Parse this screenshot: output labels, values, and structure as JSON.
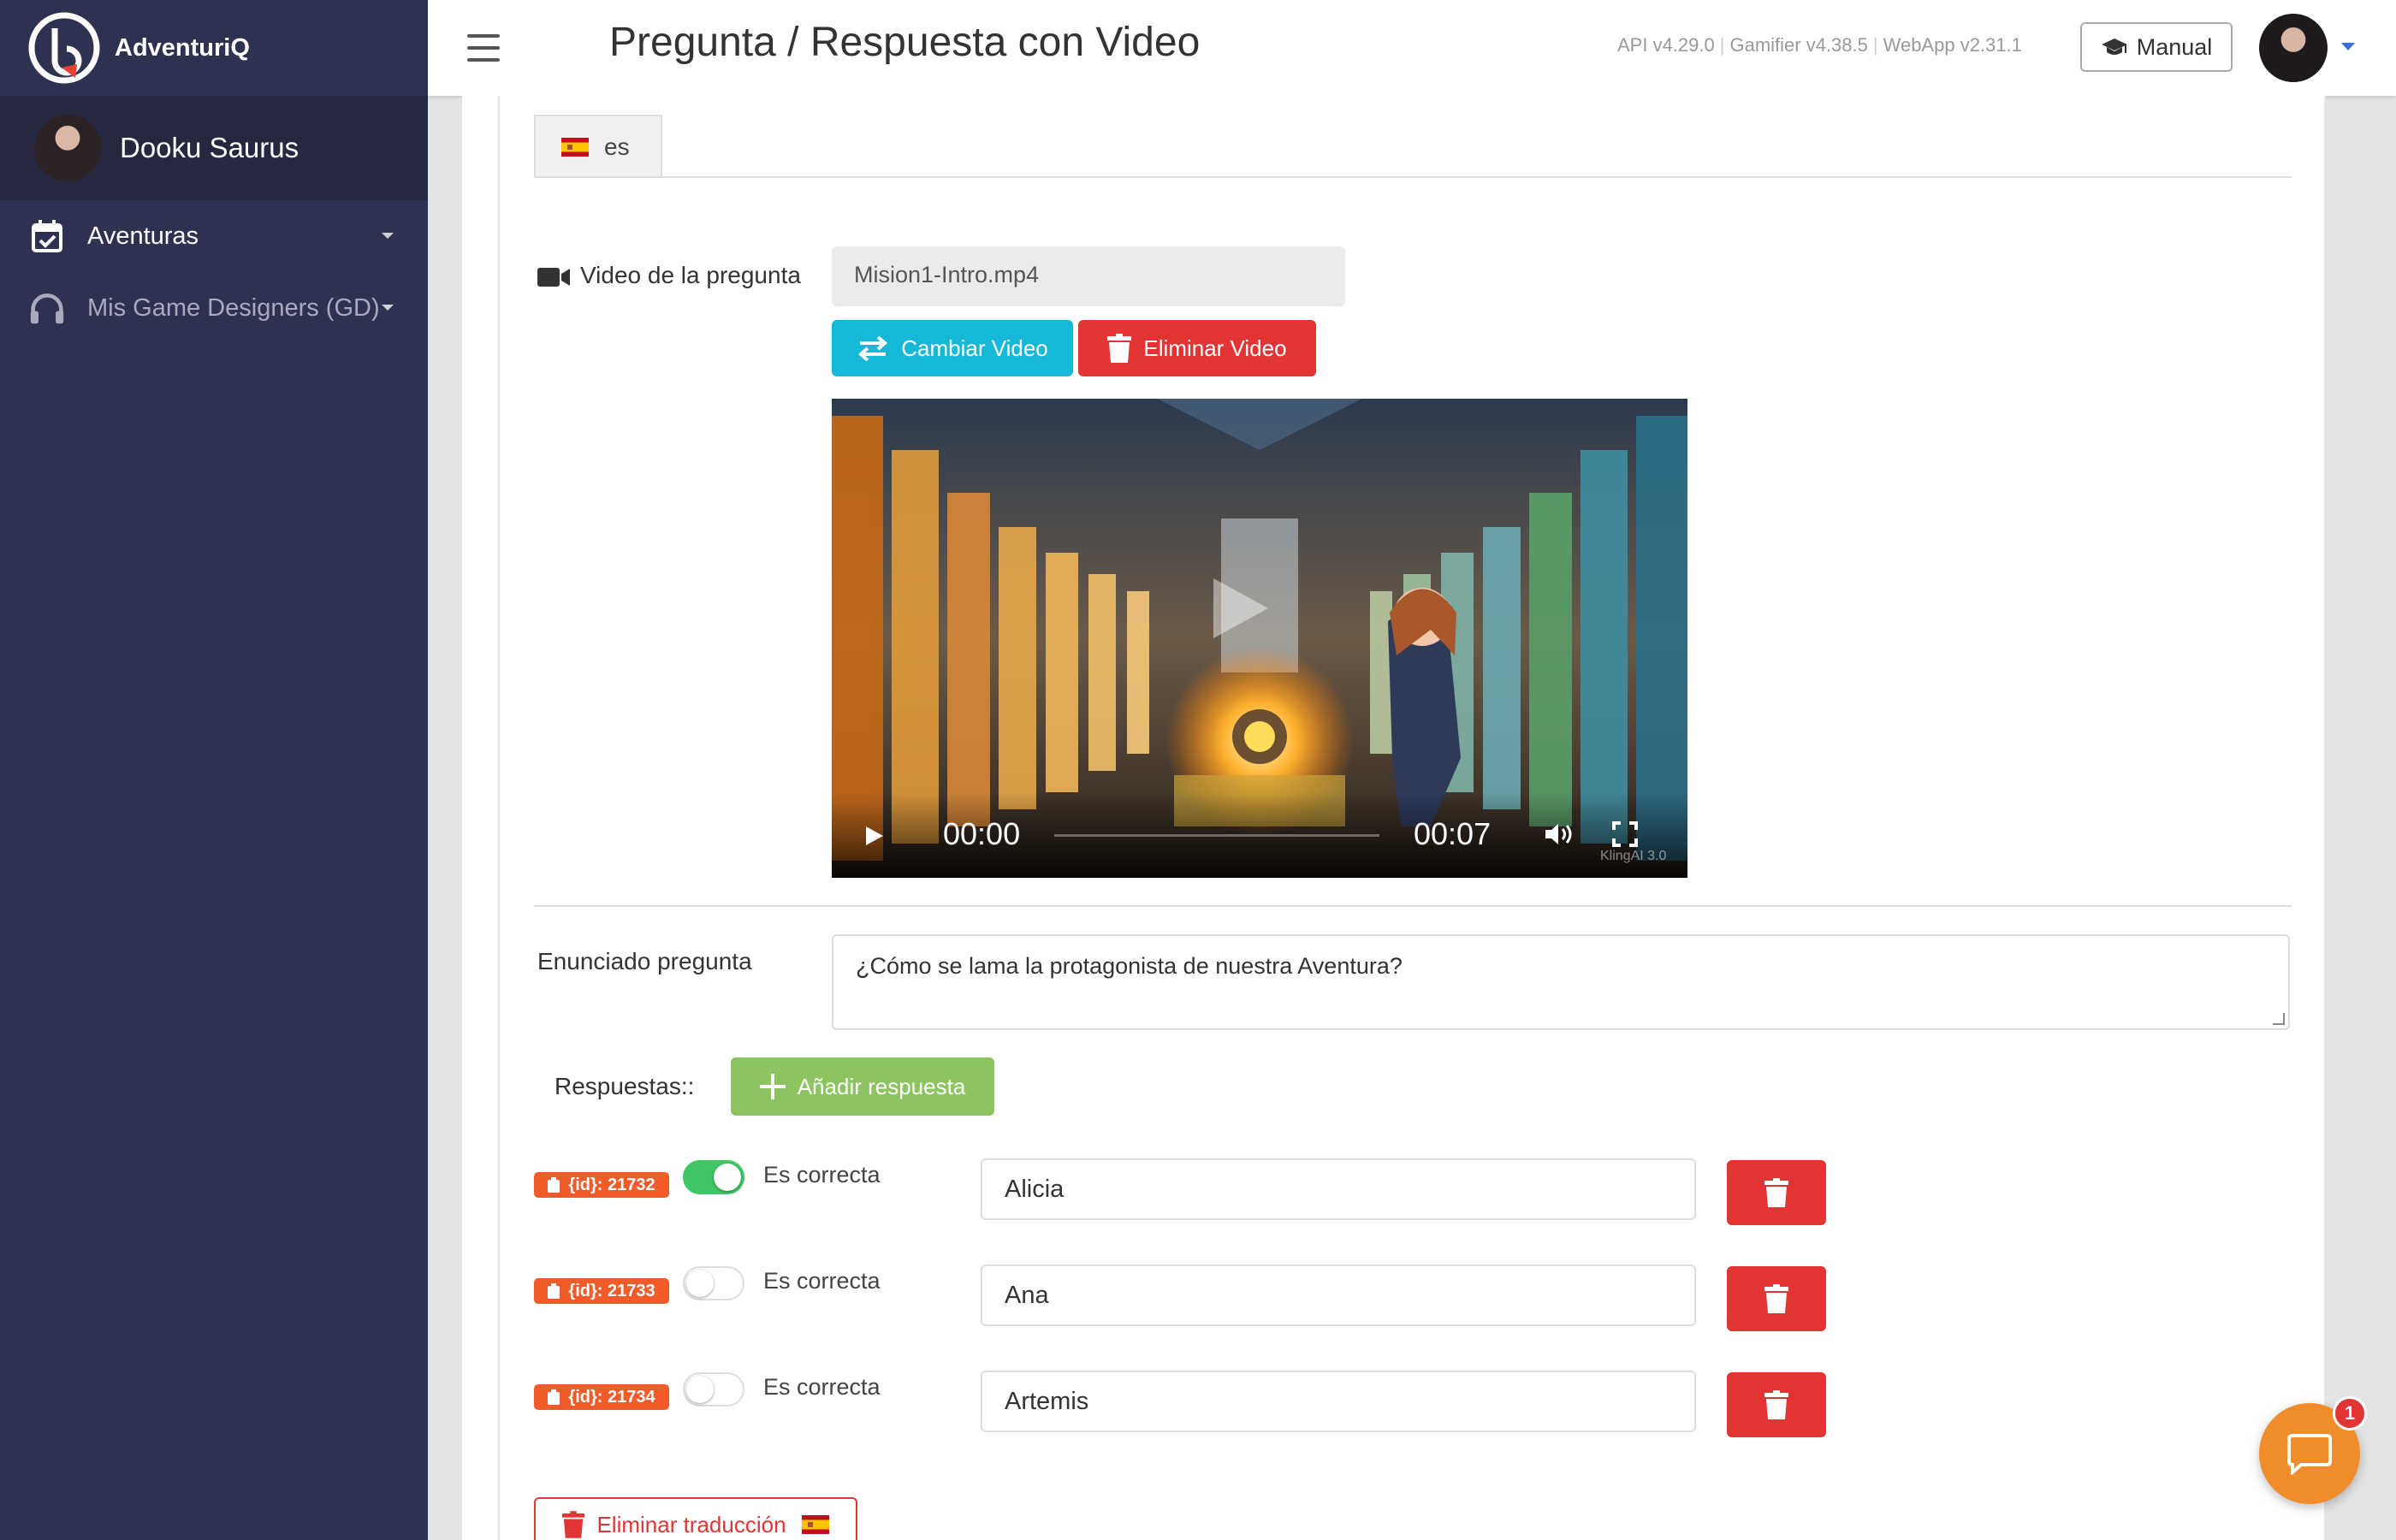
{
  "app": {
    "brand": "AdventuriQ",
    "user_name": "Dooku Saurus"
  },
  "sidebar": {
    "items": [
      {
        "label": "Aventuras",
        "icon": "calendar-check-icon"
      },
      {
        "label": "Mis Game Designers (GD)",
        "icon": "headphones-icon"
      }
    ]
  },
  "header": {
    "title": "Pregunta / Respuesta con Video",
    "versions": [
      "API v4.29.0",
      "Gamifier v4.38.5",
      "WebApp v2.31.1"
    ],
    "manual_label": "Manual"
  },
  "tabs": [
    {
      "label": "es",
      "flag": "spain-flag-icon"
    }
  ],
  "video_section": {
    "label": "Video de la pregunta",
    "file_name": "Mision1-Intro.mp4",
    "change_label": "Cambiar Video",
    "delete_label": "Eliminar Video",
    "player": {
      "current_time": "00:00",
      "duration": "00:07",
      "watermark": "KlingAI 3.0"
    }
  },
  "question": {
    "label": "Enunciado pregunta",
    "text": "¿Cómo se lama la protagonista de nuestra Aventura?"
  },
  "answers": {
    "label": "Respuestas::",
    "add_label": "Añadir respuesta",
    "correct_label": "Es correcta",
    "items": [
      {
        "id_label": "{id}: 21732",
        "value": "Alicia",
        "correct": true
      },
      {
        "id_label": "{id}: 21733",
        "value": "Ana",
        "correct": false
      },
      {
        "id_label": "{id}: 21734",
        "value": "Artemis",
        "correct": false
      }
    ]
  },
  "footer": {
    "delete_translation_label": "Eliminar traducción"
  },
  "chat": {
    "badge_count": "1"
  },
  "colors": {
    "sidebar": "#2f3150",
    "info": "#15b8d6",
    "danger": "#e23434",
    "success": "#8cc45f",
    "badge": "#f15a29",
    "chat": "#f08c2a"
  }
}
